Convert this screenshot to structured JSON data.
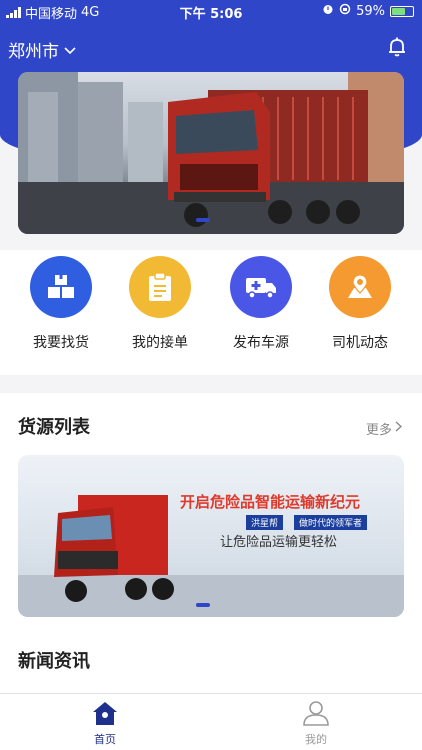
{
  "status_bar": {
    "carrier": "中国移动",
    "network": "4G",
    "time": "下午 5:06",
    "battery": "59%",
    "battery_level": 0.59
  },
  "header": {
    "city": "郑州市"
  },
  "quick_menu": [
    {
      "label": "我要找货",
      "icon": "boxes-icon",
      "color": "#2f5fe0"
    },
    {
      "label": "我的接单",
      "icon": "clipboard-icon",
      "color": "#f2b935"
    },
    {
      "label": "发布车源",
      "icon": "truck-plus-icon",
      "color": "#4a57e6"
    },
    {
      "label": "司机动态",
      "icon": "map-pin-icon",
      "color": "#f49a30"
    }
  ],
  "goods_section": {
    "title": "货源列表",
    "more": "更多"
  },
  "promo_banner": {
    "headline": "开启危险品智能运输新纪元",
    "tag1": "洪星帮",
    "tag2": "做时代的领军者",
    "subline": "让危险品运输更轻松"
  },
  "news_section": {
    "title": "新闻资讯"
  },
  "tabbar": [
    {
      "label": "首页",
      "icon": "home-icon",
      "active": true
    },
    {
      "label": "我的",
      "icon": "user-icon",
      "active": false
    }
  ],
  "colors": {
    "brand": "#2f46c9",
    "tab_active": "#1f2f8c",
    "tab_inactive": "#9a9a9a"
  }
}
